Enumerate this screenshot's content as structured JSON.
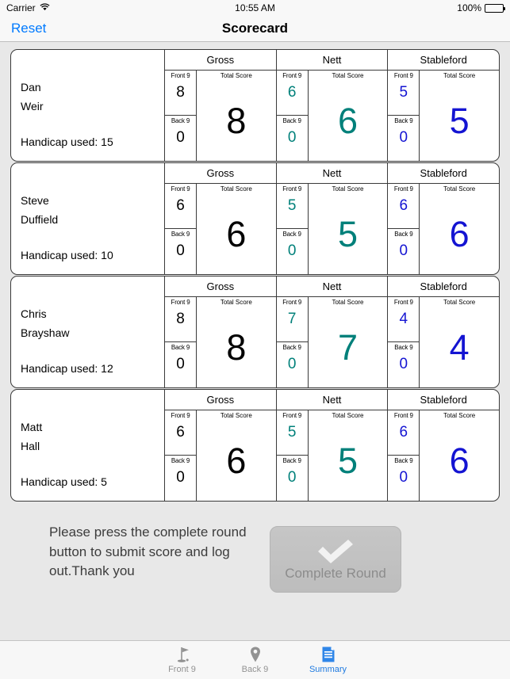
{
  "status_bar": {
    "carrier": "Carrier",
    "wifi_icon": "wifi-icon",
    "time": "10:55 AM",
    "battery_percent": "100%",
    "battery_icon": "battery-full-icon"
  },
  "nav_bar": {
    "left_button": "Reset",
    "title": "Scorecard"
  },
  "labels": {
    "front9": "Front 9",
    "back9": "Back 9",
    "total_score": "Total Score",
    "handicap_prefix": "Handicap used: "
  },
  "metric_names": {
    "gross": "Gross",
    "nett": "Nett",
    "stableford": "Stableford"
  },
  "colors": {
    "gross": "#000000",
    "nett": "#00807a",
    "stableford": "#1414d2",
    "accent": "#007aff",
    "tab_inactive": "#929292"
  },
  "players": [
    {
      "first_name": "Dan",
      "last_name": "Weir",
      "handicap_text": "Handicap used: 15",
      "handicap": 15,
      "gross": {
        "front9": "8",
        "back9": "0",
        "total": "8"
      },
      "nett": {
        "front9": "6",
        "back9": "0",
        "total": "6"
      },
      "stableford": {
        "front9": "5",
        "back9": "0",
        "total": "5"
      }
    },
    {
      "first_name": "Steve",
      "last_name": "Duffield",
      "handicap_text": "Handicap used: 10",
      "handicap": 10,
      "gross": {
        "front9": "6",
        "back9": "0",
        "total": "6"
      },
      "nett": {
        "front9": "5",
        "back9": "0",
        "total": "5"
      },
      "stableford": {
        "front9": "6",
        "back9": "0",
        "total": "6"
      }
    },
    {
      "first_name": "Chris",
      "last_name": "Brayshaw",
      "handicap_text": "Handicap used: 12",
      "handicap": 12,
      "gross": {
        "front9": "8",
        "back9": "0",
        "total": "8"
      },
      "nett": {
        "front9": "7",
        "back9": "0",
        "total": "7"
      },
      "stableford": {
        "front9": "4",
        "back9": "0",
        "total": "4"
      }
    },
    {
      "first_name": "Matt",
      "last_name": "Hall",
      "handicap_text": "Handicap used: 5",
      "handicap": 5,
      "gross": {
        "front9": "6",
        "back9": "0",
        "total": "6"
      },
      "nett": {
        "front9": "5",
        "back9": "0",
        "total": "5"
      },
      "stableford": {
        "front9": "6",
        "back9": "0",
        "total": "6"
      }
    }
  ],
  "footer": {
    "message": "Please press the complete round button to submit score and log out.Thank you",
    "complete_round_label": "Complete Round",
    "complete_round_icon": "checkmark-icon"
  },
  "tab_bar": {
    "tabs": [
      {
        "label": "Front 9",
        "icon": "golf-flag-icon",
        "active": false
      },
      {
        "label": "Back 9",
        "icon": "map-pin-icon",
        "active": false
      },
      {
        "label": "Summary",
        "icon": "document-icon",
        "active": true
      }
    ]
  }
}
